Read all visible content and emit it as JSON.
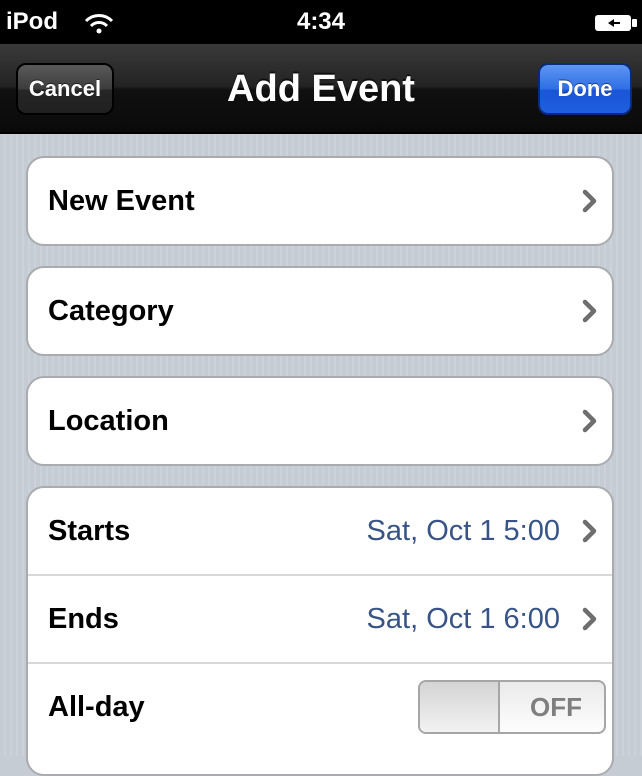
{
  "status_bar": {
    "carrier": "iPod",
    "time": "4:34"
  },
  "nav_bar": {
    "title": "Add Event",
    "cancel_label": "Cancel",
    "done_label": "Done"
  },
  "rows": {
    "title": {
      "label": "New Event"
    },
    "category": {
      "label": "Category"
    },
    "location": {
      "label": "Location"
    },
    "starts": {
      "label": "Starts",
      "value": "Sat, Oct 1 5:00"
    },
    "ends": {
      "label": "Ends",
      "value": "Sat, Oct 1 6:00"
    },
    "all_day": {
      "label": "All-day",
      "toggle_text": "OFF",
      "on": false
    }
  },
  "colors": {
    "value_text": "#385487",
    "done_button": "#2f6fe6",
    "background": "#c5ccd4"
  },
  "icons": [
    "wifi-icon",
    "battery-icon",
    "chevron-right-icon"
  ]
}
